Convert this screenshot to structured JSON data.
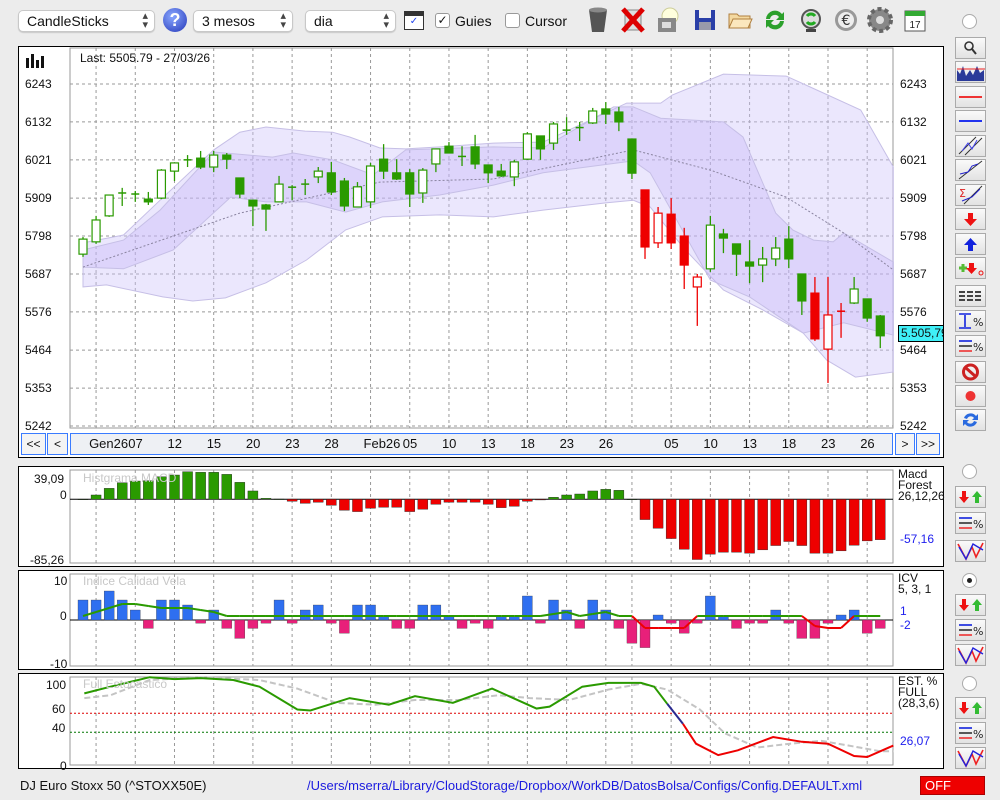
{
  "toolbar": {
    "chart_type": "CandleSticks",
    "period": "3 mesos",
    "interval": "dia",
    "guides_label": "Guies",
    "guides_checked": true,
    "cursor_label": "Cursor",
    "cursor_checked": false,
    "icons": [
      "trash-icon",
      "delete-icon",
      "print-icon",
      "save-icon",
      "open-folder-icon",
      "refresh-icon",
      "sync-icon",
      "currency-icon",
      "settings-icon",
      "calendar-icon"
    ],
    "calendar_day": "17"
  },
  "main": {
    "last_label": "Last: 5505.79 - 27/03/26",
    "last_price_tag": "5.505,79",
    "price_ticks": [
      "6243",
      "6132",
      "6021",
      "5909",
      "5798",
      "5687",
      "5576",
      "5464",
      "5353",
      "5242"
    ],
    "nav": {
      "first": "<<",
      "prev": "<",
      "next": ">",
      "last": ">>"
    },
    "date_labels": [
      {
        "i": 2,
        "t": "Gen26"
      },
      {
        "i": 5,
        "t": "07"
      },
      {
        "i": 8,
        "t": "12"
      },
      {
        "i": 11,
        "t": "15"
      },
      {
        "i": 14,
        "t": "20"
      },
      {
        "i": 17,
        "t": "23"
      },
      {
        "i": 20,
        "t": "28"
      },
      {
        "i": 23,
        "t": "Feb26"
      },
      {
        "i": 26,
        "t": "05"
      },
      {
        "i": 29,
        "t": "10"
      },
      {
        "i": 32,
        "t": "13"
      },
      {
        "i": 35,
        "t": "18"
      },
      {
        "i": 38,
        "t": "23"
      },
      {
        "i": 41,
        "t": "26"
      },
      {
        "i": 46,
        "t": "05"
      },
      {
        "i": 49,
        "t": "10"
      },
      {
        "i": 52,
        "t": "13"
      },
      {
        "i": 55,
        "t": "18"
      },
      {
        "i": 58,
        "t": "23"
      },
      {
        "i": 61,
        "t": "26"
      }
    ]
  },
  "macd": {
    "title": "Histgrama MACD",
    "max": "39,09",
    "zero": "0",
    "min": "-85,26",
    "name1": "Macd",
    "name2": "Forest",
    "params": "26,12,26",
    "last": "-57,16"
  },
  "icv": {
    "title": "Indice Calidad Vela",
    "max": "10",
    "zero": "0",
    "min": "-10",
    "name": "ICV",
    "params": "5, 3, 1",
    "val1": "1",
    "val2": "-2"
  },
  "stoch": {
    "title": "Full Estocastico",
    "t100": "100",
    "t60": "60",
    "t40": "40",
    "t0": "0",
    "name1": "EST. %",
    "name2": "FULL",
    "params": "(28,3,6)",
    "last": "26,07"
  },
  "footer": {
    "instrument": "DJ Euro Stoxx 50 (^STOXX50E)",
    "config_path": "/Users/mserra/Library/CloudStorage/Dropbox/WorkDB/DatosBolsa/Configs/Config.DEFAULT.xml",
    "status": "OFF"
  },
  "colors": {
    "up": "#2a9a00",
    "down": "#ee0000",
    "macd_pos": "#2a9a00",
    "macd_neg": "#ee0000",
    "icv_pos": "#2f6ff0",
    "icv_neg": "#e8207a",
    "cyan": "#3ff0f8"
  },
  "chart_data": {
    "type": "candlestick",
    "ylim": [
      5242,
      6243
    ],
    "grid_indices": [
      2,
      5,
      8,
      11,
      14,
      17,
      20,
      23,
      26,
      29,
      32,
      35,
      38,
      41,
      43,
      46,
      49,
      52,
      55,
      58,
      61
    ],
    "candles": [
      [
        5745,
        5795,
        5737,
        5789,
        "g"
      ],
      [
        5781,
        5857,
        5775,
        5845,
        "g"
      ],
      [
        5857,
        5918,
        5854,
        5918,
        "g"
      ],
      [
        5922,
        5939,
        5886,
        5926,
        "g"
      ],
      [
        5920,
        5930,
        5898,
        5922,
        "g"
      ],
      [
        5906,
        5927,
        5889,
        5898,
        "g"
      ],
      [
        5909,
        5994,
        5906,
        5991,
        "g"
      ],
      [
        5988,
        6012,
        5959,
        6012,
        "g"
      ],
      [
        6020,
        6035,
        6000,
        6022,
        "g"
      ],
      [
        6026,
        6047,
        5994,
        6000,
        "g"
      ],
      [
        6000,
        6047,
        5985,
        6035,
        "g"
      ],
      [
        6035,
        6041,
        5994,
        6023,
        "g"
      ],
      [
        5968,
        5968,
        5909,
        5921,
        "g"
      ],
      [
        5903,
        5903,
        5827,
        5886,
        "g"
      ],
      [
        5889,
        5892,
        5813,
        5877,
        "g"
      ],
      [
        5898,
        5974,
        5898,
        5950,
        "g"
      ],
      [
        5940,
        5947,
        5903,
        5942,
        "g"
      ],
      [
        5947,
        5965,
        5918,
        5953,
        "g"
      ],
      [
        5971,
        6000,
        5953,
        5988,
        "g"
      ],
      [
        5983,
        6015,
        5918,
        5927,
        "g"
      ],
      [
        5959,
        5968,
        5871,
        5886,
        "g"
      ],
      [
        5883,
        5956,
        5883,
        5942,
        "g"
      ],
      [
        5898,
        6012,
        5880,
        6003,
        "g"
      ],
      [
        6023,
        6067,
        5965,
        5988,
        "g"
      ],
      [
        5983,
        6023,
        5962,
        5965,
        "g"
      ],
      [
        5983,
        5994,
        5883,
        5921,
        "g"
      ],
      [
        5924,
        5997,
        5895,
        5991,
        "g"
      ],
      [
        6009,
        6053,
        5985,
        6053,
        "g"
      ],
      [
        6061,
        6073,
        6041,
        6041,
        "g"
      ],
      [
        6030,
        6061,
        6003,
        6032,
        "g"
      ],
      [
        6059,
        6094,
        5994,
        6009,
        "g"
      ],
      [
        6006,
        6006,
        5953,
        5983,
        "g"
      ],
      [
        5988,
        6009,
        5971,
        5974,
        "g"
      ],
      [
        5971,
        6021,
        5944,
        6015,
        "g"
      ],
      [
        6023,
        6102,
        6021,
        6097,
        "g"
      ],
      [
        6091,
        6091,
        6021,
        6053,
        "g"
      ],
      [
        6070,
        6132,
        6050,
        6126,
        "g"
      ],
      [
        6106,
        6146,
        6094,
        6110,
        "g"
      ],
      [
        6114,
        6132,
        6076,
        6117,
        "g"
      ],
      [
        6129,
        6173,
        6126,
        6164,
        "g"
      ],
      [
        6170,
        6190,
        6126,
        6155,
        "g"
      ],
      [
        6161,
        6176,
        6105,
        6132,
        "g"
      ],
      [
        6082,
        6082,
        5965,
        5982,
        "g"
      ],
      [
        5933,
        5933,
        5731,
        5766,
        "r"
      ],
      [
        5778,
        5883,
        5763,
        5865,
        "r"
      ],
      [
        5862,
        5909,
        5760,
        5778,
        "r"
      ],
      [
        5798,
        5822,
        5643,
        5713,
        "r"
      ],
      [
        5649,
        5687,
        5535,
        5678,
        "r"
      ],
      [
        5702,
        5857,
        5693,
        5830,
        "g"
      ],
      [
        5804,
        5819,
        5748,
        5792,
        "g"
      ],
      [
        5775,
        5775,
        5681,
        5745,
        "g"
      ],
      [
        5722,
        5786,
        5660,
        5710,
        "g"
      ],
      [
        5713,
        5766,
        5663,
        5731,
        "g"
      ],
      [
        5731,
        5795,
        5710,
        5763,
        "g"
      ],
      [
        5789,
        5827,
        5704,
        5731,
        "g"
      ],
      [
        5687,
        5687,
        5567,
        5608,
        "g"
      ],
      [
        5631,
        5678,
        5491,
        5497,
        "r"
      ],
      [
        5467,
        5678,
        5368,
        5567,
        "r"
      ],
      [
        5577,
        5602,
        5500,
        5579,
        "r"
      ],
      [
        5602,
        5678,
        5599,
        5643,
        "g"
      ],
      [
        5614,
        5614,
        5547,
        5558,
        "g"
      ],
      [
        5564,
        5567,
        5470,
        5506,
        "g"
      ]
    ],
    "bollinger": {
      "outer_upper": [
        [
          0,
          5778
        ],
        [
          3.1,
          5801
        ],
        [
          5.9,
          5903
        ],
        [
          10,
          6050
        ],
        [
          12,
          6102
        ],
        [
          14,
          6117
        ],
        [
          17,
          6105
        ],
        [
          19.1,
          6102
        ],
        [
          20.4,
          6088
        ],
        [
          22.7,
          6056
        ],
        [
          24.7,
          6053
        ],
        [
          27.3,
          6059
        ],
        [
          31.4,
          6070
        ],
        [
          35.2,
          6073
        ],
        [
          41.6,
          6187
        ],
        [
          44.2,
          6187
        ],
        [
          45.1,
          6211
        ],
        [
          49,
          6272
        ],
        [
          53.8,
          6266
        ],
        [
          55.3,
          6240
        ],
        [
          59.5,
          6167
        ],
        [
          62,
          6000
        ]
      ],
      "outer_lower": [
        [
          0,
          5649
        ],
        [
          1.8,
          5655
        ],
        [
          6.1,
          5620
        ],
        [
          8.4,
          5608
        ],
        [
          10.9,
          5617
        ],
        [
          14,
          5661
        ],
        [
          17.1,
          5728
        ],
        [
          20.1,
          5816
        ],
        [
          22.9,
          5854
        ],
        [
          27.3,
          5860
        ],
        [
          31.4,
          5854
        ],
        [
          35.2,
          5874
        ],
        [
          40,
          5895
        ],
        [
          42.1,
          5903
        ],
        [
          43.4,
          5883
        ],
        [
          46.1,
          5757
        ],
        [
          49,
          5640
        ],
        [
          52,
          5582
        ],
        [
          55.1,
          5514
        ],
        [
          56.9,
          5435
        ],
        [
          59.1,
          5385
        ],
        [
          62,
          5400
        ]
      ],
      "inner_upper": [
        [
          0,
          5757
        ],
        [
          3.1,
          5786
        ],
        [
          5.9,
          5874
        ],
        [
          10,
          6044
        ],
        [
          14.5,
          6029
        ],
        [
          16.1,
          6041
        ],
        [
          19.1,
          6021
        ],
        [
          22.2,
          5977
        ],
        [
          24.7,
          6050
        ],
        [
          31.4,
          6059
        ],
        [
          35.2,
          6056
        ],
        [
          40.6,
          6176
        ],
        [
          42.1,
          6176
        ],
        [
          44.2,
          6143
        ],
        [
          49,
          6132
        ],
        [
          50.5,
          6088
        ],
        [
          53,
          5865
        ],
        [
          54.3,
          5816
        ],
        [
          55.9,
          5786
        ],
        [
          57.4,
          5781
        ],
        [
          58.2,
          5807
        ],
        [
          62,
          5722
        ]
      ],
      "inner_lower": [
        [
          0,
          5707
        ],
        [
          3.1,
          5702
        ],
        [
          6.9,
          5757
        ],
        [
          11.3,
          5912
        ],
        [
          14,
          5898
        ],
        [
          17.1,
          5898
        ],
        [
          20.1,
          5868
        ],
        [
          22.9,
          5898
        ],
        [
          27.3,
          5918
        ],
        [
          31.4,
          5947
        ],
        [
          35.2,
          5983
        ],
        [
          42.1,
          6018
        ],
        [
          43.4,
          5983
        ],
        [
          48,
          5669
        ],
        [
          51,
          5620
        ],
        [
          55.1,
          5514
        ],
        [
          58.2,
          5544
        ],
        [
          62,
          5508
        ]
      ],
      "middle": [
        [
          0,
          5707
        ],
        [
          12,
          5865
        ],
        [
          22.7,
          5956
        ],
        [
          31.4,
          5965
        ],
        [
          42.1,
          6050
        ],
        [
          48,
          5991
        ],
        [
          53.8,
          5912
        ],
        [
          58.2,
          5807
        ],
        [
          62,
          5699
        ]
      ]
    },
    "macd_hist": [
      0,
      6.1,
      15.5,
      23.5,
      25.9,
      26.4,
      32,
      34.4,
      39.09,
      38.2,
      38.2,
      35.3,
      24,
      11.8,
      1.4,
      0.3,
      -2.8,
      -5.7,
      -4.2,
      -8.5,
      -15.5,
      -17.4,
      -12.7,
      -11.3,
      -11.3,
      -17.4,
      -14.1,
      -7.1,
      -4.2,
      -4.2,
      -4.2,
      -7.1,
      -11.8,
      -9.9,
      -2.8,
      -0.9,
      2.8,
      6.1,
      7.5,
      11.8,
      14.1,
      12.7,
      0,
      -28.7,
      -41,
      -55.6,
      -70.7,
      -85.26,
      -77.7,
      -74.9,
      -74.9,
      -76.3,
      -71.6,
      -65.5,
      -59.8,
      -65.5,
      -76.3,
      -76.3,
      -73,
      -65,
      -58.9,
      -57.16
    ],
    "icv_bars": [
      5,
      5,
      7.25,
      5,
      2.5,
      -2.1,
      5,
      5,
      3.75,
      -0.8,
      2.5,
      -2.1,
      -4.6,
      -2.1,
      -0.8,
      5,
      -0.8,
      2.5,
      3.75,
      -0.8,
      -3.3,
      3.75,
      3.75,
      0.8,
      -2.1,
      -2.1,
      3.75,
      3.75,
      0.8,
      -2.1,
      -0.8,
      -2.1,
      0.8,
      0.8,
      6,
      -0.8,
      5,
      2.5,
      -2.1,
      5,
      2.5,
      -2.1,
      -5.8,
      -6.9,
      1.25,
      -0.8,
      -3.3,
      -0.8,
      6,
      0.8,
      -2.1,
      -0.8,
      -0.8,
      2.5,
      -0.8,
      -4.6,
      -4.6,
      -0.8,
      1.25,
      2.5,
      -3.3,
      -2.1
    ],
    "icv_line": [
      1,
      2,
      3,
      4,
      4,
      3.5,
      3,
      3,
      3,
      2.5,
      2,
      1,
      1,
      1,
      1,
      1,
      1,
      1,
      1,
      1,
      1,
      1,
      1,
      1,
      1,
      1,
      1,
      1,
      1,
      1,
      1,
      1,
      1,
      1,
      1,
      1,
      1.5,
      2,
      1,
      1.5,
      2,
      1,
      1,
      -2,
      -2,
      -2,
      -2,
      1,
      1,
      1,
      1,
      1,
      1,
      1,
      1,
      1,
      -1.5,
      -2,
      -2,
      1,
      1,
      1
    ],
    "icv_line_red": [
      44,
      45,
      46,
      47,
      57,
      58,
      59
    ],
    "stoch_k": [
      {
        "color": "#2a9a00",
        "points": [
          [
            0.1,
            81
          ],
          [
            2.1,
            88
          ],
          [
            5.1,
            98
          ],
          [
            7,
            96
          ],
          [
            9,
            97
          ],
          [
            11.5,
            95
          ],
          [
            13.5,
            88
          ],
          [
            16.4,
            64
          ],
          [
            17.4,
            63
          ],
          [
            20.4,
            76
          ],
          [
            23.4,
            69
          ],
          [
            25.4,
            78
          ],
          [
            28.3,
            71
          ],
          [
            31.3,
            86
          ],
          [
            34.7,
            65
          ],
          [
            35.7,
            67
          ],
          [
            38.2,
            88
          ],
          [
            40.2,
            92
          ],
          [
            42.7,
            92
          ],
          [
            43.7,
            88
          ],
          [
            44.7,
            70
          ]
        ]
      },
      {
        "color": "#2a2a90",
        "points": [
          [
            44.7,
            70
          ],
          [
            45.9,
            49
          ]
        ]
      },
      {
        "color": "#ee0000",
        "points": [
          [
            45.9,
            49
          ],
          [
            46.9,
            28
          ],
          [
            48.6,
            16
          ],
          [
            50.1,
            21
          ],
          [
            52.8,
            35
          ],
          [
            55,
            30
          ],
          [
            57,
            28
          ],
          [
            59,
            15
          ],
          [
            60,
            14
          ],
          [
            62,
            26.07
          ]
        ]
      }
    ],
    "stoch_d": [
      [
        0.1,
        76
      ],
      [
        2.1,
        79
      ],
      [
        5.1,
        95
      ],
      [
        9,
        98
      ],
      [
        13.5,
        95
      ],
      [
        16.4,
        86
      ],
      [
        19.4,
        71
      ],
      [
        22.4,
        69
      ],
      [
        25.4,
        74
      ],
      [
        28.8,
        74
      ],
      [
        31.8,
        79
      ],
      [
        34.2,
        76
      ],
      [
        37.2,
        74
      ],
      [
        40.2,
        85
      ],
      [
        42.7,
        91
      ],
      [
        44.7,
        85
      ],
      [
        47.2,
        64
      ],
      [
        49.1,
        39
      ],
      [
        51.6,
        24
      ],
      [
        54.1,
        28
      ],
      [
        56.5,
        31
      ],
      [
        59,
        25
      ],
      [
        61,
        20
      ],
      [
        62,
        20
      ]
    ],
    "stoch_levels": [
      {
        "v": 60,
        "color": "#dd0000"
      },
      {
        "v": 40,
        "color": "#007700"
      }
    ]
  },
  "sidebar": {
    "tools": [
      "zoom-icon",
      "chart-thumbnail-icon",
      "red-horizontal-line-icon",
      "blue-horizontal-line-icon",
      "channel-icon",
      "trend-lines-icon",
      "sigma-lines-icon",
      "sell-arrow-icon",
      "buy-arrow-icon",
      "add-signal-icon",
      "dashed-lines-icon",
      "range-percent-icon",
      "lines-percent-icon",
      "no-entry-icon",
      "record-icon",
      "refresh-icon"
    ]
  }
}
